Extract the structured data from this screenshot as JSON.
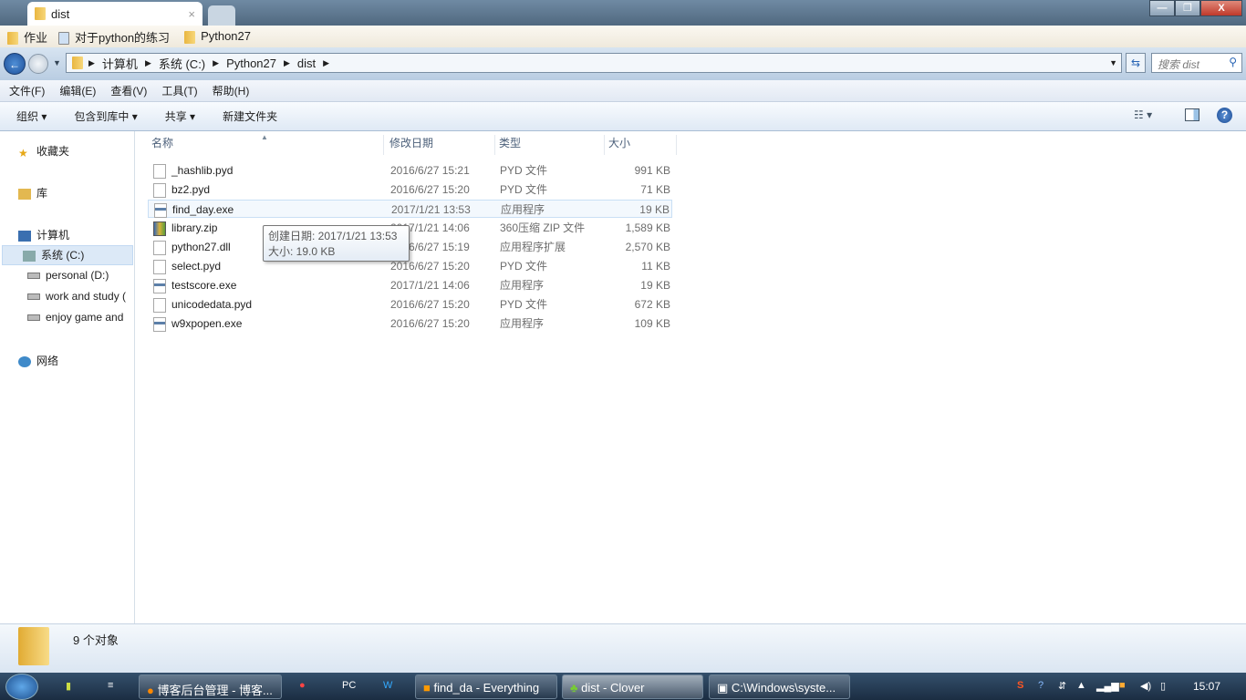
{
  "window": {
    "tab_title": "dist",
    "tab_close": "×",
    "minimize": "—",
    "restore": "❐",
    "close": "X"
  },
  "bookmarks": [
    {
      "label": "作业"
    },
    {
      "label": "对于python的练习"
    },
    {
      "label": "Python27"
    }
  ],
  "address": {
    "crumbs": [
      "计算机",
      "系统 (C:)",
      "Python27",
      "dist"
    ],
    "search_placeholder": "搜索 dist"
  },
  "menu": [
    "文件(F)",
    "编辑(E)",
    "查看(V)",
    "工具(T)",
    "帮助(H)"
  ],
  "toolbar": {
    "organize": "组织 ▾",
    "include_library": "包含到库中 ▾",
    "share": "共享 ▾",
    "new_folder": "新建文件夹"
  },
  "nav": {
    "favorites": "收藏夹",
    "libraries": "库",
    "computer": "计算机",
    "drives": [
      "系统 (C:)",
      "personal (D:)",
      "work and study (",
      "enjoy game and"
    ],
    "network": "网络"
  },
  "columns": {
    "name": "名称",
    "date": "修改日期",
    "type": "类型",
    "size": "大小"
  },
  "files": [
    {
      "name": "_hashlib.pyd",
      "date": "2016/6/27 15:21",
      "type": "PYD 文件",
      "size": "991 KB",
      "icon": "file"
    },
    {
      "name": "bz2.pyd",
      "date": "2016/6/27 15:20",
      "type": "PYD 文件",
      "size": "71 KB",
      "icon": "file"
    },
    {
      "name": "find_day.exe",
      "date": "2017/1/21 13:53",
      "type": "应用程序",
      "size": "19 KB",
      "icon": "exe"
    },
    {
      "name": "library.zip",
      "date": "2017/1/21 14:06",
      "type": "360压缩 ZIP 文件",
      "size": "1,589 KB",
      "icon": "zip"
    },
    {
      "name": "python27.dll",
      "date": "2016/6/27 15:19",
      "type": "应用程序扩展",
      "size": "2,570 KB",
      "icon": "file"
    },
    {
      "name": "select.pyd",
      "date": "2016/6/27 15:20",
      "type": "PYD 文件",
      "size": "11 KB",
      "icon": "file"
    },
    {
      "name": "testscore.exe",
      "date": "2017/1/21 14:06",
      "type": "应用程序",
      "size": "19 KB",
      "icon": "exe"
    },
    {
      "name": "unicodedata.pyd",
      "date": "2016/6/27 15:20",
      "type": "PYD 文件",
      "size": "672 KB",
      "icon": "file"
    },
    {
      "name": "w9xpopen.exe",
      "date": "2016/6/27 15:20",
      "type": "应用程序",
      "size": "109 KB",
      "icon": "exe"
    }
  ],
  "tooltip": {
    "created": "创建日期: 2017/1/21 13:53",
    "size": "大小: 19.0 KB"
  },
  "status": {
    "count": "9 个对象"
  },
  "taskbar": {
    "items": [
      "博客后台管理 - 博客...",
      "find_da - Everything",
      "dist - Clover",
      "C:\\Windows\\syste..."
    ],
    "clock": "15:07"
  }
}
